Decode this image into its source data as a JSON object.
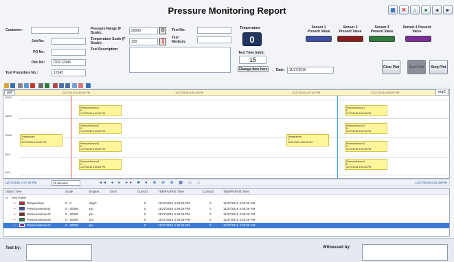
{
  "header": {
    "title": "Pressure Monitoring Report"
  },
  "window_buttons": [
    {
      "name": "grid-icon",
      "glyph": "▦",
      "color": "#3a6fb5"
    },
    {
      "name": "close-icon",
      "glyph": "✕",
      "color": "#c8202a"
    },
    {
      "name": "save-icon",
      "glyph": "⌂",
      "color": "#2d8a3c"
    },
    {
      "name": "record-icon",
      "glyph": "●",
      "color": "#1a7a30"
    },
    {
      "name": "prev-icon",
      "glyph": "◂",
      "color": "#333"
    },
    {
      "name": "next-icon",
      "glyph": "▸",
      "color": "#333"
    }
  ],
  "form": {
    "customer_label": "Customer:",
    "job_label": "Job No:",
    "po_label": "PO No:",
    "doc_label": "Doc No:",
    "doc_value": "DOC12345",
    "procedure_label": "Test Procedure No.:",
    "procedure_value": "12345",
    "pressure_range_label": "Pressure Range (F Scale):",
    "pressure_range_value": "20000",
    "temp_scale_label": "Temperature Scale (F Scale):",
    "temp_scale_value": "120",
    "test_description_label": "Test Description:",
    "test_no_label": "Test No:",
    "test_medium_label": "Test Medium:",
    "temperature_label": "Temperature",
    "temperature_value": "0",
    "test_time_label": "Test Time (min):",
    "test_time_value": "15",
    "change_time_label": "Change time here",
    "date_label": "Date:",
    "date_value": "11/27/2016"
  },
  "sensors": [
    {
      "header": "Sensor 1 Present Value",
      "color": "#3e4fa8"
    },
    {
      "header": "Sensor 2 Present Value",
      "color": "#8a1e1e"
    },
    {
      "header": "Sensor 3 Present Value",
      "color": "#2e7d3a"
    },
    {
      "header": "Sensor 4 Present Value",
      "color": "#7b2e9a"
    }
  ],
  "buttons": {
    "clear_plot": "Clear Plot",
    "start_plot": "Start Plot",
    "stop_plot": "Stop Plot"
  },
  "chart": {
    "tab_left": "grid",
    "tab_right": "drgC",
    "time_labels": [
      "11/27/2016 4:45:00 PM",
      "11/27/2016 4:46:00 PM",
      "11/27/2016 4:47:00 PM",
      "11/27/2016 4:48:00 PM"
    ],
    "y_labels": [
      "20000",
      "16000",
      "12000",
      "8000",
      "4000"
    ],
    "annotations": [
      {
        "lines": [
          "PressureSensor1",
          "P: ...",
          "11/27/2016 4:46:26 PM"
        ]
      },
      {
        "lines": [
          "PressureSensor2",
          "P: ...",
          "11/27/2016 4:46:26 PM"
        ]
      },
      {
        "lines": [
          "PressureSensor3",
          "P: ...",
          "11/27/2016 4:46:26 PM"
        ]
      },
      {
        "lines": [
          "PressureSensor4",
          "P: ...",
          "11/27/2016 4:46:26 PM"
        ]
      },
      {
        "lines": [
          "Temperature",
          "T: ...",
          "11/27/2016 4:46:26 PM"
        ]
      },
      {
        "lines": [
          "Temperature",
          "T: ...",
          "11/27/2016 4:50:26 PM"
        ]
      },
      {
        "lines": [
          "PressureSensor1",
          "P: ...",
          "11/27/2016 4:50:26 PM"
        ]
      },
      {
        "lines": [
          "PressureSensor2",
          "P: ...",
          "11/27/2016 4:50:26 PM"
        ]
      },
      {
        "lines": [
          "PressureSensor3",
          "P: ...",
          "11/27/2016 4:50:26 PM"
        ]
      },
      {
        "lines": [
          "PressureSensor4",
          "P: ...",
          "11/27/2016 4:50:26 PM"
        ]
      }
    ]
  },
  "navbar": {
    "left_time": "11/27/2016 4:47:29 PM",
    "interval": "15 Minutes",
    "right_time": "11/27/2016 5:02:29 PM"
  },
  "grid": {
    "headers": [
      "Object Tree",
      "Scale",
      "Engine...",
      "Error",
      "Cursor1",
      "TEMP/VARIE Time",
      "Cursor2",
      "TEMP/VARIE Time"
    ],
    "root_label": "Tree Panel",
    "rows": [
      {
        "name": "Temperature",
        "scale": "0 - 0",
        "unit": "degC",
        "cursor1": "0",
        "time1": "11/27/2016 4:46:26 PM",
        "cursor2": "0",
        "time2": "11/27/2016 4:50:26 PM",
        "color": "#c62828"
      },
      {
        "name": "PressureSensor1",
        "scale": "0 - 20000",
        "unit": "psi",
        "cursor1": "0",
        "time1": "11/27/2016 4:46:26 PM",
        "cursor2": "0",
        "time2": "11/27/2016 4:50:26 PM",
        "color": "#3e4fa8"
      },
      {
        "name": "PressureSensor2",
        "scale": "0 - 20000",
        "unit": "psi",
        "cursor1": "0",
        "time1": "11/27/2016 4:46:26 PM",
        "cursor2": "0",
        "time2": "11/27/2016 4:50:26 PM",
        "color": "#8a1e1e"
      },
      {
        "name": "PressureSensor3",
        "scale": "0 - 20000",
        "unit": "psi",
        "cursor1": "0",
        "time1": "11/27/2016 4:46:26 PM",
        "cursor2": "0",
        "time2": "11/27/2016 4:50:26 PM",
        "color": "#2e7d3a"
      },
      {
        "name": "PressureSensor4",
        "scale": "0 - 20000",
        "unit": "psi",
        "cursor1": "0",
        "time1": "11/27/2016 4:46:26 PM",
        "cursor2": "0",
        "time2": "11/27/2016 4:50:26 PM",
        "color": "#7b2e9a"
      }
    ]
  },
  "footer": {
    "tested_by": "Test by:",
    "witnessed_by": "Witnessed by:"
  }
}
